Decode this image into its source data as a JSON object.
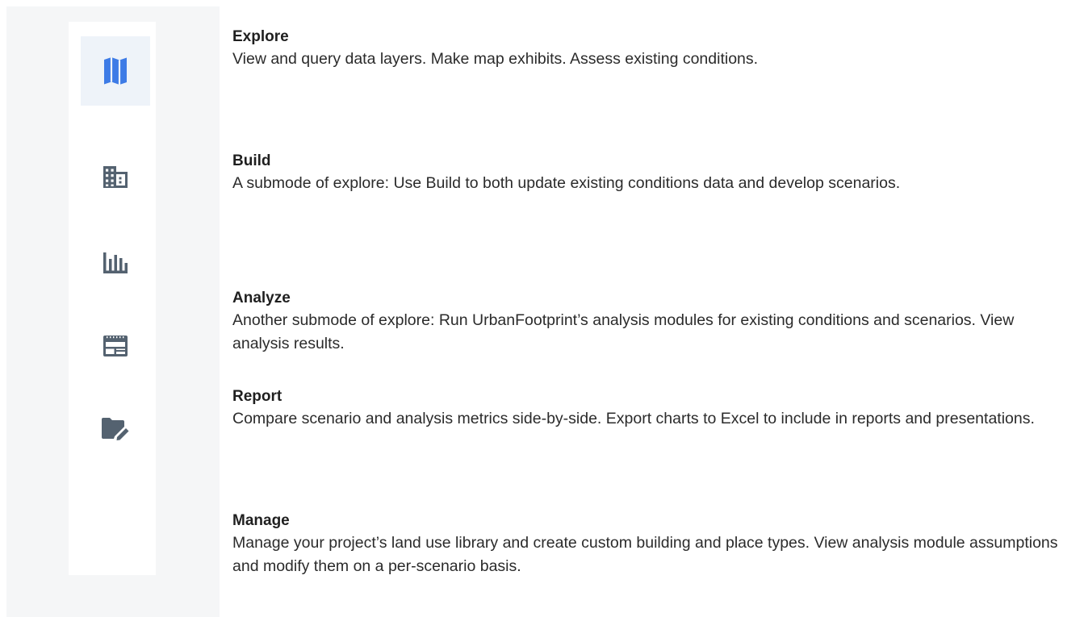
{
  "modes": [
    {
      "key": "explore",
      "icon": "map-icon",
      "active": true,
      "title": "Explore",
      "description": "View and query data layers. Make map exhibits. Assess existing conditions."
    },
    {
      "key": "build",
      "icon": "building-icon",
      "active": false,
      "title": "Build",
      "description": "A submode of explore: Use Build to both update existing conditions data and develop scenarios."
    },
    {
      "key": "analyze",
      "icon": "bar-chart-icon",
      "active": false,
      "title": "Analyze",
      "description": "Another submode of explore: Run UrbanFootprint’s analysis modules for existing conditions and scenarios. View analysis results."
    },
    {
      "key": "report",
      "icon": "report-icon",
      "active": false,
      "title": "Report",
      "description": "Compare scenario and analysis metrics side-by-side. Export charts to Excel to include in reports and presentations."
    },
    {
      "key": "manage",
      "icon": "folder-edit-icon",
      "active": false,
      "title": "Manage",
      "description": "Manage your project’s land use library and create custom building and place types. View analysis module assumptions and modify them on a per-scenario basis."
    }
  ],
  "colors": {
    "active_icon": "#3d7be6",
    "inactive_icon": "#546270",
    "active_background": "#eef3f9",
    "panel_background": "#f5f6f7"
  }
}
